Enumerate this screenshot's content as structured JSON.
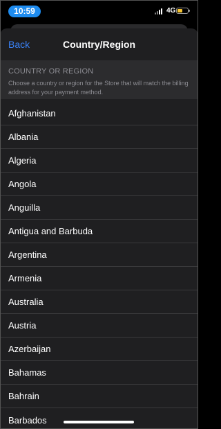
{
  "status_bar": {
    "time": "10:59",
    "network": "4G",
    "battery_color": "#f6c431",
    "time_pill_color": "#1e8cf0"
  },
  "nav": {
    "back_label": "Back",
    "title": "Country/Region",
    "accent_color": "#3a82f7"
  },
  "section": {
    "header": "COUNTRY OR REGION",
    "description": "Choose a country or region for the Store that will match the billing address for your payment method."
  },
  "countries": [
    "Afghanistan",
    "Albania",
    "Algeria",
    "Angola",
    "Anguilla",
    "Antigua and Barbuda",
    "Argentina",
    "Armenia",
    "Australia",
    "Austria",
    "Azerbaijan",
    "Bahamas",
    "Bahrain",
    "Barbados"
  ]
}
